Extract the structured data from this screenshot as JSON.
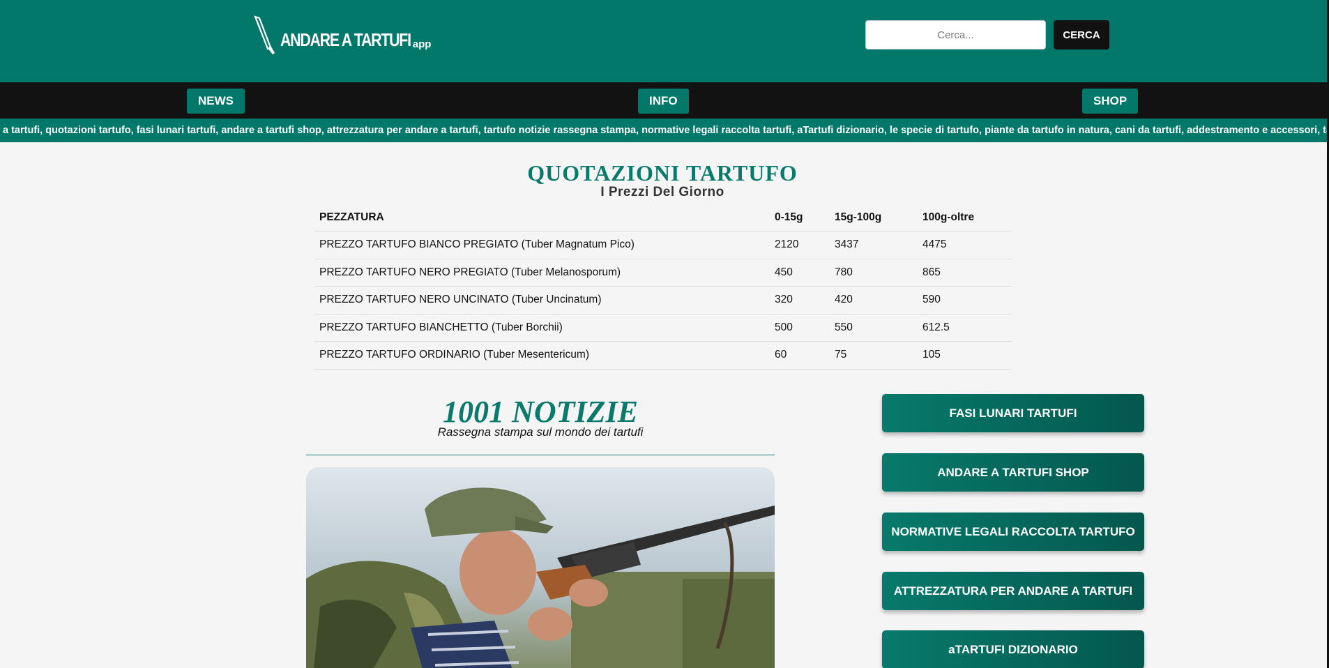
{
  "header": {
    "logo_text": "ANDARE A TARTUFI",
    "logo_suffix": "app",
    "search_placeholder": "Cerca...",
    "search_button": "CERCA"
  },
  "nav": {
    "items": [
      {
        "label": "NEWS"
      },
      {
        "label": "INFO"
      },
      {
        "label": "SHOP"
      }
    ]
  },
  "ticker": {
    "text": "a tartufi, quotazioni tartufo, fasi lunari tartufi, andare a tartufi shop, attrezzatura per andare a tartufi, tartufo notizie rassegna stampa, normative legali raccolta tartufi, aTartufi dizionario, le specie di tartufo, piante da tartufo in natura, cani da tartufi, addestramento e accessori, tartufo r"
  },
  "quotazioni": {
    "title": "QUOTAZIONI TARTUFO",
    "subtitle": "I Prezzi Del Giorno",
    "headers": [
      "PEZZATURA",
      "0-15g",
      "15g-100g",
      "100g-oltre"
    ],
    "rows": [
      [
        "PREZZO TARTUFO BIANCO PREGIATO (Tuber Magnatum Pico)",
        "2120",
        "3437",
        "4475"
      ],
      [
        "PREZZO TARTUFO NERO PREGIATO (Tuber Melanosporum)",
        "450",
        "780",
        "865"
      ],
      [
        "PREZZO TARTUFO NERO UNCINATO (Tuber Uncinatum)",
        "320",
        "420",
        "590"
      ],
      [
        "PREZZO TARTUFO BIANCHETTO (Tuber Borchii)",
        "500",
        "550",
        "612.5"
      ],
      [
        "PREZZO TARTUFO ORDINARIO (Tuber Mesentericum)",
        "60",
        "75",
        "105"
      ]
    ]
  },
  "news": {
    "title": "1001 NOTIZIE",
    "subtitle": "Rassegna stampa sul mondo dei tartufi"
  },
  "sidebar": {
    "buttons": [
      {
        "label": "FASI LUNARI TARTUFI"
      },
      {
        "label": "ANDARE A TARTUFI SHOP"
      },
      {
        "label": "NORMATIVE LEGALI RACCOLTA TARTUFO"
      },
      {
        "label": "ATTREZZATURA PER ANDARE A TARTUFI"
      },
      {
        "label": "aTARTUFI DIZIONARIO"
      }
    ]
  },
  "colors": {
    "brand": "#02786b",
    "nav_bg": "#121212",
    "page_bg": "#f5f5f5"
  }
}
